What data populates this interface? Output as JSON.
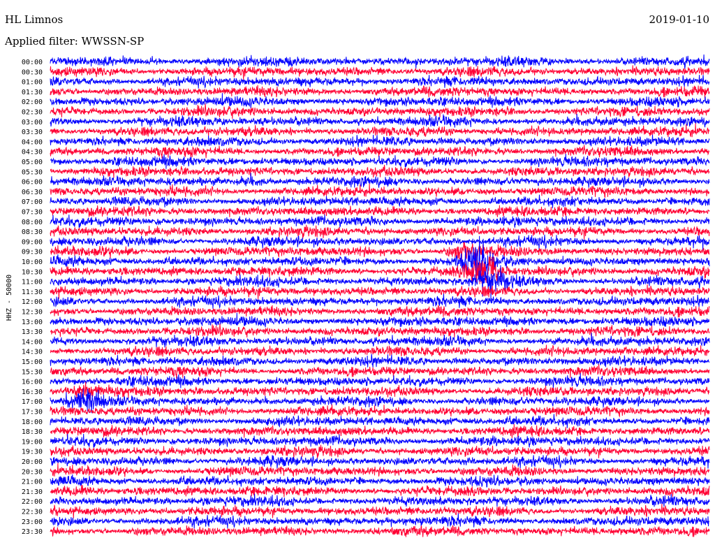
{
  "header": {
    "station": "HL Limnos",
    "date": "2019-01-10",
    "filter_label": "Applied filter: WWSSN-SP"
  },
  "chart_data": {
    "type": "line",
    "ylabel": "HHZ - 50000",
    "rows": [
      "00:00",
      "00:30",
      "01:00",
      "01:30",
      "02:00",
      "02:30",
      "03:00",
      "03:30",
      "04:00",
      "04:30",
      "05:00",
      "05:30",
      "06:00",
      "06:30",
      "07:00",
      "07:30",
      "08:00",
      "08:30",
      "09:00",
      "09:30",
      "10:00",
      "10:30",
      "11:00",
      "11:30",
      "12:00",
      "12:30",
      "13:00",
      "13:30",
      "14:00",
      "14:30",
      "15:00",
      "15:30",
      "16:00",
      "16:30",
      "17:00",
      "17:30",
      "18:00",
      "18:30",
      "19:00",
      "19:30",
      "20:00",
      "20:30",
      "21:00",
      "21:30",
      "22:00",
      "22:30",
      "23:00",
      "23:30"
    ],
    "trace_colors": [
      "#0000ff",
      "#ff0033"
    ],
    "grid": false,
    "events": [
      {
        "row": "06:00",
        "x_fraction": 0.31,
        "amplitude": 1.6
      },
      {
        "row": "09:30",
        "x_fraction": 0.63,
        "amplitude": 3.0
      },
      {
        "row": "10:00",
        "x_fraction": 0.65,
        "amplitude": 4.0
      },
      {
        "row": "10:30",
        "x_fraction": 0.66,
        "amplitude": 4.5
      },
      {
        "row": "11:00",
        "x_fraction": 0.67,
        "amplitude": 3.5
      },
      {
        "row": "16:30",
        "x_fraction": 0.05,
        "amplitude": 2.5
      },
      {
        "row": "17:00",
        "x_fraction": 0.055,
        "amplitude": 2.8
      },
      {
        "row": "21:30",
        "x_fraction": 0.05,
        "amplitude": 1.5
      }
    ]
  }
}
